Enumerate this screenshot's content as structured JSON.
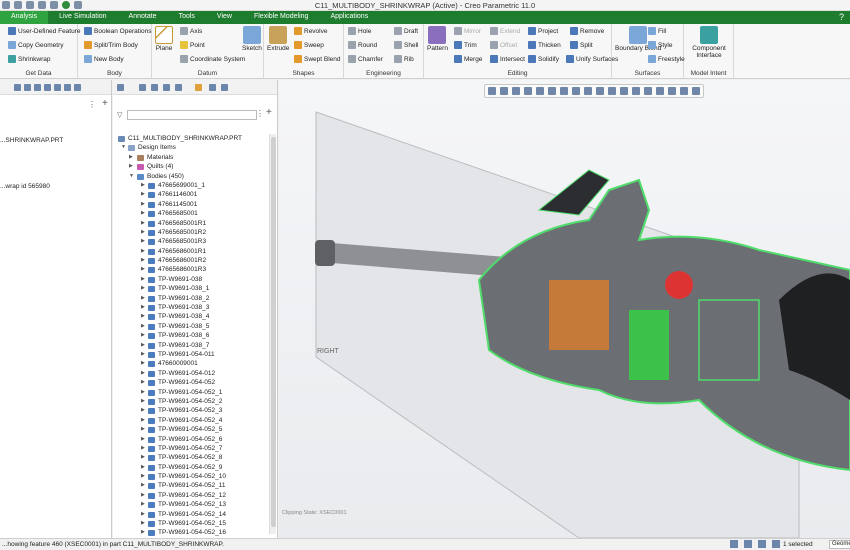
{
  "window": {
    "title": "C11_MULTIBODY_SHRINKWRAP (Active) - Creo Parametric 11.0"
  },
  "tabs": [
    "Analysis",
    "Live Simulation",
    "Annotate",
    "Tools",
    "View",
    "Flexible Modeling",
    "Applications"
  ],
  "active_tab": "Analysis",
  "ribbon": {
    "get_data": {
      "label": "Get Data",
      "items": [
        "User-Defined Feature",
        "Copy Geometry",
        "Shrinkwrap"
      ]
    },
    "body": {
      "label": "Body",
      "items": [
        "Boolean Operations",
        "Split/Trim Body",
        "New Body"
      ]
    },
    "datum": {
      "label": "Datum",
      "plane": "Plane",
      "items": [
        "Axis",
        "Point",
        "Coordinate System"
      ],
      "sketch": "Sketch"
    },
    "shapes": {
      "label": "Shapes",
      "extrude": "Extrude",
      "items": [
        "Revolve",
        "Sweep",
        "Swept Blend"
      ]
    },
    "engineering": {
      "label": "Engineering",
      "items": [
        "Hole",
        "Round",
        "Chamfer",
        "Draft",
        "Shell",
        "Rib"
      ]
    },
    "editing": {
      "label": "Editing",
      "pattern": "Pattern",
      "items": [
        "Mirror",
        "Extend",
        "Project",
        "Remove",
        "Trim",
        "Offset",
        "Thicken",
        "Split",
        "Merge",
        "Intersect",
        "Solidify",
        "Unify Surfaces"
      ]
    },
    "surfaces": {
      "label": "Surfaces",
      "boundary": "Boundary Blend",
      "items": [
        "Fill",
        "Style",
        "Freestyle"
      ]
    },
    "model_intent": {
      "label": "Model Intent",
      "component": "Component Interface"
    }
  },
  "left_pane": {
    "part": "...SHRINKWRAP.PRT",
    "info": "...wrap id 565980"
  },
  "tree": {
    "root": "C11_MULTIBODY_SHRINKWRAP.PRT",
    "design_items": "Design Items",
    "materials": "Materials",
    "quilts": "Quilts (4)",
    "bodies": "Bodies (450)",
    "body_items": [
      "47665699001_1",
      "47661146001",
      "47661145001",
      "47665685001",
      "47665685001R1",
      "47665685001R2",
      "47665685001R3",
      "47665686001R1",
      "47665686001R2",
      "47665686001R3",
      "TP-W9691-038",
      "TP-W9691-038_1",
      "TP-W9691-038_2",
      "TP-W9691-038_3",
      "TP-W9691-038_4",
      "TP-W9691-038_5",
      "TP-W9691-038_6",
      "TP-W9691-038_7",
      "TP-W9691-054-011",
      "47660009001",
      "TP-W9691-054-012",
      "TP-W9691-054-052",
      "TP-W9691-054-052_1",
      "TP-W9691-054-052_2",
      "TP-W9691-054-052_3",
      "TP-W9691-054-052_4",
      "TP-W9691-054-052_5",
      "TP-W9691-054-052_6",
      "TP-W9691-054-052_7",
      "TP-W9691-054-052_8",
      "TP-W9691-054-052_9",
      "TP-W9691-054-052_10",
      "TP-W9691-054-052_11",
      "TP-W9691-054-052_12",
      "TP-W9691-054-052_13",
      "TP-W9691-054-052_14",
      "TP-W9691-054-052_15",
      "TP-W9691-054-052_16"
    ]
  },
  "viewport": {
    "plane_label": "RIGHT",
    "clipping_state": "Clipping State: XSEC0001"
  },
  "status": {
    "message": "...howing feature 460 (XSEC0001) in part C11_MULTIBODY_SHRINKWRAP.",
    "selected": "1 selected",
    "filter": "Geome"
  },
  "colors": {
    "ribbon_green": "#1e7c2e",
    "active_tab": "#2fa33f",
    "shrinkwrap_green": "#4fdc6a"
  }
}
